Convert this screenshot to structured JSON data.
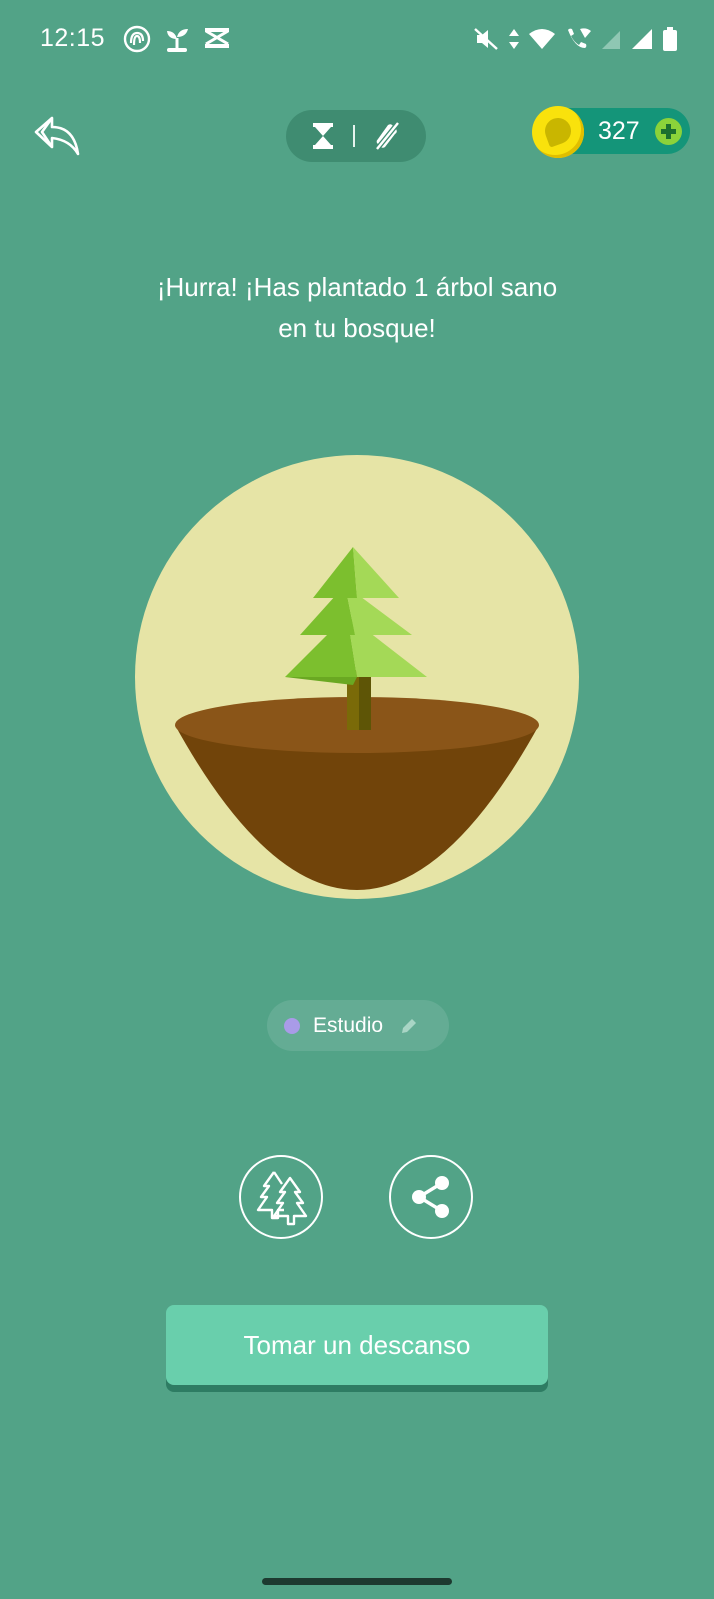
{
  "status_bar": {
    "time": "12:15"
  },
  "top_bar": {
    "coin_count": "327"
  },
  "message": {
    "line1": "¡Hurra! ¡Has plantado 1 árbol sano",
    "line2": "en tu bosque!"
  },
  "tag": {
    "label": "Estudio",
    "dot_color": "#a99be8"
  },
  "actions": {
    "break_label": "Tomar un descanso"
  },
  "colors": {
    "background": "#52a387",
    "circle": "#e6e4a6",
    "soil": "#71440a",
    "leaves": "#8bd23a",
    "button": "#69cfac"
  }
}
